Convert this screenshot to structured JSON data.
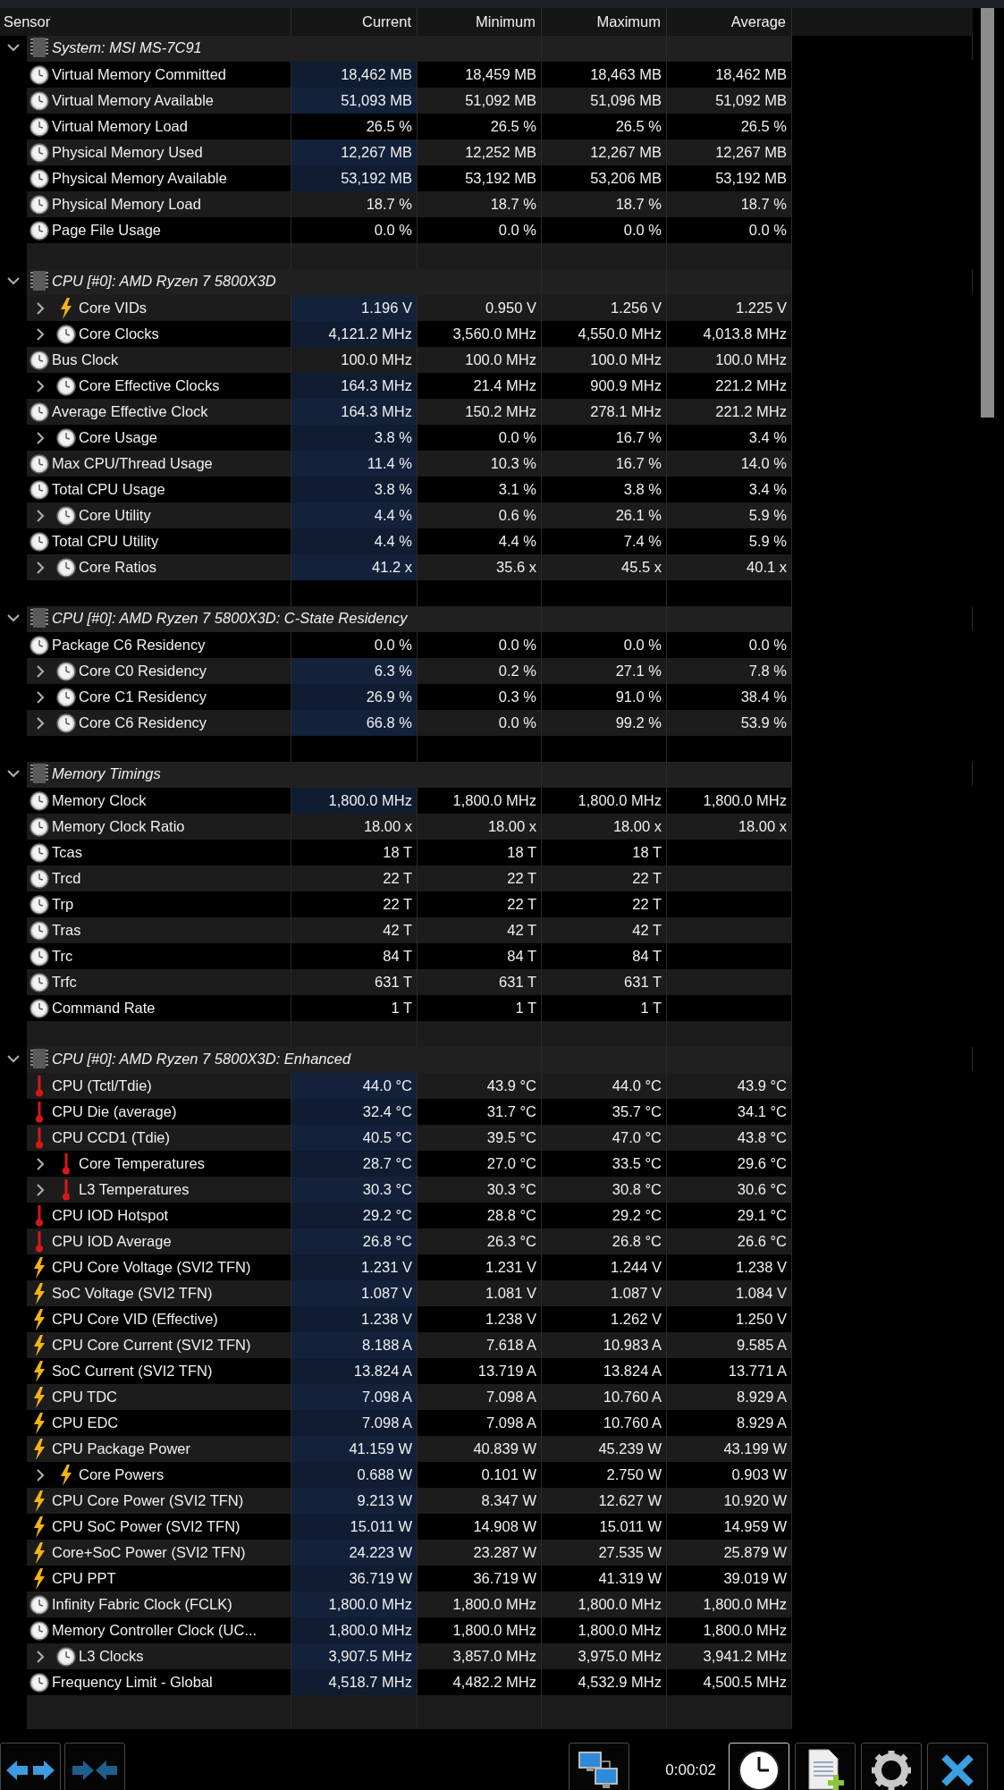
{
  "columns": [
    "Sensor",
    "Current",
    "Minimum",
    "Maximum",
    "Average"
  ],
  "groups": [
    {
      "title": "System: MSI MS-7C91",
      "expanded": true,
      "rows": [
        {
          "name": "Virtual Memory Committed",
          "kind": "clock",
          "expandable": false,
          "highlighted": true,
          "current": "18,462 MB",
          "minimum": "18,459 MB",
          "maximum": "18,463 MB",
          "average": "18,462 MB"
        },
        {
          "name": "Virtual Memory Available",
          "kind": "clock",
          "expandable": false,
          "highlighted": true,
          "current": "51,093 MB",
          "minimum": "51,092 MB",
          "maximum": "51,096 MB",
          "average": "51,092 MB"
        },
        {
          "name": "Virtual Memory Load",
          "kind": "clock",
          "expandable": false,
          "highlighted": false,
          "current": "26.5 %",
          "minimum": "26.5 %",
          "maximum": "26.5 %",
          "average": "26.5 %"
        },
        {
          "name": "Physical Memory Used",
          "kind": "clock",
          "expandable": false,
          "highlighted": true,
          "current": "12,267 MB",
          "minimum": "12,252 MB",
          "maximum": "12,267 MB",
          "average": "12,267 MB"
        },
        {
          "name": "Physical Memory Available",
          "kind": "clock",
          "expandable": false,
          "highlighted": true,
          "current": "53,192 MB",
          "minimum": "53,192 MB",
          "maximum": "53,206 MB",
          "average": "53,192 MB"
        },
        {
          "name": "Physical Memory Load",
          "kind": "clock",
          "expandable": false,
          "highlighted": false,
          "current": "18.7 %",
          "minimum": "18.7 %",
          "maximum": "18.7 %",
          "average": "18.7 %"
        },
        {
          "name": "Page File Usage",
          "kind": "clock",
          "expandable": false,
          "highlighted": false,
          "current": "0.0 %",
          "minimum": "0.0 %",
          "maximum": "0.0 %",
          "average": "0.0 %"
        }
      ]
    },
    {
      "title": "CPU [#0]: AMD Ryzen 7 5800X3D",
      "expanded": true,
      "rows": [
        {
          "name": "Core VIDs",
          "kind": "bolt",
          "expandable": true,
          "highlighted": true,
          "current": "1.196 V",
          "minimum": "0.950 V",
          "maximum": "1.256 V",
          "average": "1.225 V"
        },
        {
          "name": "Core Clocks",
          "kind": "clock",
          "expandable": true,
          "highlighted": true,
          "current": "4,121.2 MHz",
          "minimum": "3,560.0 MHz",
          "maximum": "4,550.0 MHz",
          "average": "4,013.8 MHz"
        },
        {
          "name": "Bus Clock",
          "kind": "clock",
          "expandable": false,
          "highlighted": false,
          "current": "100.0 MHz",
          "minimum": "100.0 MHz",
          "maximum": "100.0 MHz",
          "average": "100.0 MHz"
        },
        {
          "name": "Core Effective Clocks",
          "kind": "clock",
          "expandable": true,
          "highlighted": true,
          "current": "164.3 MHz",
          "minimum": "21.4 MHz",
          "maximum": "900.9 MHz",
          "average": "221.2 MHz"
        },
        {
          "name": "Average Effective Clock",
          "kind": "clock",
          "expandable": false,
          "highlighted": true,
          "current": "164.3 MHz",
          "minimum": "150.2 MHz",
          "maximum": "278.1 MHz",
          "average": "221.2 MHz"
        },
        {
          "name": "Core Usage",
          "kind": "clock",
          "expandable": true,
          "highlighted": true,
          "current": "3.8 %",
          "minimum": "0.0 %",
          "maximum": "16.7 %",
          "average": "3.4 %"
        },
        {
          "name": "Max CPU/Thread Usage",
          "kind": "clock",
          "expandable": false,
          "highlighted": true,
          "current": "11.4 %",
          "minimum": "10.3 %",
          "maximum": "16.7 %",
          "average": "14.0 %"
        },
        {
          "name": "Total CPU Usage",
          "kind": "clock",
          "expandable": false,
          "highlighted": true,
          "current": "3.8 %",
          "minimum": "3.1 %",
          "maximum": "3.8 %",
          "average": "3.4 %"
        },
        {
          "name": "Core Utility",
          "kind": "clock",
          "expandable": true,
          "highlighted": true,
          "current": "4.4 %",
          "minimum": "0.6 %",
          "maximum": "26.1 %",
          "average": "5.9 %"
        },
        {
          "name": "Total CPU Utility",
          "kind": "clock",
          "expandable": false,
          "highlighted": true,
          "current": "4.4 %",
          "minimum": "4.4 %",
          "maximum": "7.4 %",
          "average": "5.9 %"
        },
        {
          "name": "Core Ratios",
          "kind": "clock",
          "expandable": true,
          "highlighted": true,
          "current": "41.2 x",
          "minimum": "35.6 x",
          "maximum": "45.5 x",
          "average": "40.1 x"
        }
      ]
    },
    {
      "title": "CPU [#0]: AMD Ryzen 7 5800X3D: C-State Residency",
      "expanded": true,
      "rows": [
        {
          "name": "Package C6 Residency",
          "kind": "clock",
          "expandable": false,
          "highlighted": false,
          "current": "0.0 %",
          "minimum": "0.0 %",
          "maximum": "0.0 %",
          "average": "0.0 %"
        },
        {
          "name": "Core C0 Residency",
          "kind": "clock",
          "expandable": true,
          "highlighted": true,
          "current": "6.3 %",
          "minimum": "0.2 %",
          "maximum": "27.1 %",
          "average": "7.8 %"
        },
        {
          "name": "Core C1 Residency",
          "kind": "clock",
          "expandable": true,
          "highlighted": true,
          "current": "26.9 %",
          "minimum": "0.3 %",
          "maximum": "91.0 %",
          "average": "38.4 %"
        },
        {
          "name": "Core C6 Residency",
          "kind": "clock",
          "expandable": true,
          "highlighted": true,
          "current": "66.8 %",
          "minimum": "0.0 %",
          "maximum": "99.2 %",
          "average": "53.9 %"
        }
      ]
    },
    {
      "title": "Memory Timings",
      "expanded": true,
      "rows": [
        {
          "name": "Memory Clock",
          "kind": "clock",
          "expandable": false,
          "highlighted": true,
          "current": "1,800.0 MHz",
          "minimum": "1,800.0 MHz",
          "maximum": "1,800.0 MHz",
          "average": "1,800.0 MHz"
        },
        {
          "name": "Memory Clock Ratio",
          "kind": "clock",
          "expandable": false,
          "highlighted": false,
          "current": "18.00 x",
          "minimum": "18.00 x",
          "maximum": "18.00 x",
          "average": "18.00 x"
        },
        {
          "name": "Tcas",
          "kind": "clock",
          "expandable": false,
          "highlighted": false,
          "current": "18 T",
          "minimum": "18 T",
          "maximum": "18 T"
        },
        {
          "name": "Trcd",
          "kind": "clock",
          "expandable": false,
          "highlighted": false,
          "current": "22 T",
          "minimum": "22 T",
          "maximum": "22 T"
        },
        {
          "name": "Trp",
          "kind": "clock",
          "expandable": false,
          "highlighted": false,
          "current": "22 T",
          "minimum": "22 T",
          "maximum": "22 T"
        },
        {
          "name": "Tras",
          "kind": "clock",
          "expandable": false,
          "highlighted": false,
          "current": "42 T",
          "minimum": "42 T",
          "maximum": "42 T"
        },
        {
          "name": "Trc",
          "kind": "clock",
          "expandable": false,
          "highlighted": false,
          "current": "84 T",
          "minimum": "84 T",
          "maximum": "84 T"
        },
        {
          "name": "Trfc",
          "kind": "clock",
          "expandable": false,
          "highlighted": false,
          "current": "631 T",
          "minimum": "631 T",
          "maximum": "631 T"
        },
        {
          "name": "Command Rate",
          "kind": "clock",
          "expandable": false,
          "highlighted": false,
          "current": "1 T",
          "minimum": "1 T",
          "maximum": "1 T"
        }
      ]
    },
    {
      "title": "CPU [#0]: AMD Ryzen 7 5800X3D: Enhanced",
      "expanded": true,
      "rows": [
        {
          "name": "CPU (Tctl/Tdie)",
          "kind": "thermometer",
          "expandable": false,
          "highlighted": true,
          "current": "44.0 °C",
          "minimum": "43.9 °C",
          "maximum": "44.0 °C",
          "average": "43.9 °C"
        },
        {
          "name": "CPU Die (average)",
          "kind": "thermometer",
          "expandable": false,
          "highlighted": true,
          "current": "32.4 °C",
          "minimum": "31.7 °C",
          "maximum": "35.7 °C",
          "average": "34.1 °C"
        },
        {
          "name": "CPU CCD1 (Tdie)",
          "kind": "thermometer",
          "expandable": false,
          "highlighted": true,
          "current": "40.5 °C",
          "minimum": "39.5 °C",
          "maximum": "47.0 °C",
          "average": "43.8 °C"
        },
        {
          "name": "Core Temperatures",
          "kind": "thermometer",
          "expandable": true,
          "highlighted": true,
          "current": "28.7 °C",
          "minimum": "27.0 °C",
          "maximum": "33.5 °C",
          "average": "29.6 °C"
        },
        {
          "name": "L3 Temperatures",
          "kind": "thermometer",
          "expandable": true,
          "highlighted": true,
          "current": "30.3 °C",
          "minimum": "30.3 °C",
          "maximum": "30.8 °C",
          "average": "30.6 °C"
        },
        {
          "name": "CPU IOD Hotspot",
          "kind": "thermometer",
          "expandable": false,
          "highlighted": true,
          "current": "29.2 °C",
          "minimum": "28.8 °C",
          "maximum": "29.2 °C",
          "average": "29.1 °C"
        },
        {
          "name": "CPU IOD Average",
          "kind": "thermometer",
          "expandable": false,
          "highlighted": true,
          "current": "26.8 °C",
          "minimum": "26.3 °C",
          "maximum": "26.8 °C",
          "average": "26.6 °C"
        },
        {
          "name": "CPU Core Voltage (SVI2 TFN)",
          "kind": "bolt",
          "expandable": false,
          "highlighted": true,
          "current": "1.231 V",
          "minimum": "1.231 V",
          "maximum": "1.244 V",
          "average": "1.238 V"
        },
        {
          "name": "SoC Voltage (SVI2 TFN)",
          "kind": "bolt",
          "expandable": false,
          "highlighted": true,
          "current": "1.087 V",
          "minimum": "1.081 V",
          "maximum": "1.087 V",
          "average": "1.084 V"
        },
        {
          "name": "CPU Core VID (Effective)",
          "kind": "bolt",
          "expandable": false,
          "highlighted": true,
          "current": "1.238 V",
          "minimum": "1.238 V",
          "maximum": "1.262 V",
          "average": "1.250 V"
        },
        {
          "name": "CPU Core Current (SVI2 TFN)",
          "kind": "bolt",
          "expandable": false,
          "highlighted": true,
          "current": "8.188 A",
          "minimum": "7.618 A",
          "maximum": "10.983 A",
          "average": "9.585 A"
        },
        {
          "name": "SoC Current (SVI2 TFN)",
          "kind": "bolt",
          "expandable": false,
          "highlighted": true,
          "current": "13.824 A",
          "minimum": "13.719 A",
          "maximum": "13.824 A",
          "average": "13.771 A"
        },
        {
          "name": "CPU TDC",
          "kind": "bolt",
          "expandable": false,
          "highlighted": true,
          "current": "7.098 A",
          "minimum": "7.098 A",
          "maximum": "10.760 A",
          "average": "8.929 A"
        },
        {
          "name": "CPU EDC",
          "kind": "bolt",
          "expandable": false,
          "highlighted": true,
          "current": "7.098 A",
          "minimum": "7.098 A",
          "maximum": "10.760 A",
          "average": "8.929 A"
        },
        {
          "name": "CPU Package Power",
          "kind": "bolt",
          "expandable": false,
          "highlighted": true,
          "current": "41.159 W",
          "minimum": "40.839 W",
          "maximum": "45.239 W",
          "average": "43.199 W"
        },
        {
          "name": "Core Powers",
          "kind": "bolt",
          "expandable": true,
          "highlighted": true,
          "current": "0.688 W",
          "minimum": "0.101 W",
          "maximum": "2.750 W",
          "average": "0.903 W"
        },
        {
          "name": "CPU Core Power (SVI2 TFN)",
          "kind": "bolt",
          "expandable": false,
          "highlighted": true,
          "current": "9.213 W",
          "minimum": "8.347 W",
          "maximum": "12.627 W",
          "average": "10.920 W"
        },
        {
          "name": "CPU SoC Power (SVI2 TFN)",
          "kind": "bolt",
          "expandable": false,
          "highlighted": true,
          "current": "15.011 W",
          "minimum": "14.908 W",
          "maximum": "15.011 W",
          "average": "14.959 W"
        },
        {
          "name": "Core+SoC Power (SVI2 TFN)",
          "kind": "bolt",
          "expandable": false,
          "highlighted": true,
          "current": "24.223 W",
          "minimum": "23.287 W",
          "maximum": "27.535 W",
          "average": "25.879 W"
        },
        {
          "name": "CPU PPT",
          "kind": "bolt",
          "expandable": false,
          "highlighted": true,
          "current": "36.719 W",
          "minimum": "36.719 W",
          "maximum": "41.319 W",
          "average": "39.019 W"
        },
        {
          "name": "Infinity Fabric Clock (FCLK)",
          "kind": "clock",
          "expandable": false,
          "highlighted": true,
          "current": "1,800.0 MHz",
          "minimum": "1,800.0 MHz",
          "maximum": "1,800.0 MHz",
          "average": "1,800.0 MHz"
        },
        {
          "name": "Memory Controller Clock (UC...",
          "kind": "clock",
          "expandable": false,
          "highlighted": true,
          "current": "1,800.0 MHz",
          "minimum": "1,800.0 MHz",
          "maximum": "1,800.0 MHz",
          "average": "1,800.0 MHz"
        },
        {
          "name": "L3 Clocks",
          "kind": "clock",
          "expandable": true,
          "highlighted": true,
          "current": "3,907.5 MHz",
          "minimum": "3,857.0 MHz",
          "maximum": "3,975.0 MHz",
          "average": "3,941.2 MHz"
        },
        {
          "name": "Frequency Limit - Global",
          "kind": "clock",
          "expandable": false,
          "highlighted": true,
          "current": "4,518.7 MHz",
          "minimum": "4,482.2 MHz",
          "maximum": "4,532.9 MHz",
          "average": "4,500.5 MHz"
        }
      ]
    }
  ],
  "toolbar": {
    "elapsed": "0:00:02"
  }
}
